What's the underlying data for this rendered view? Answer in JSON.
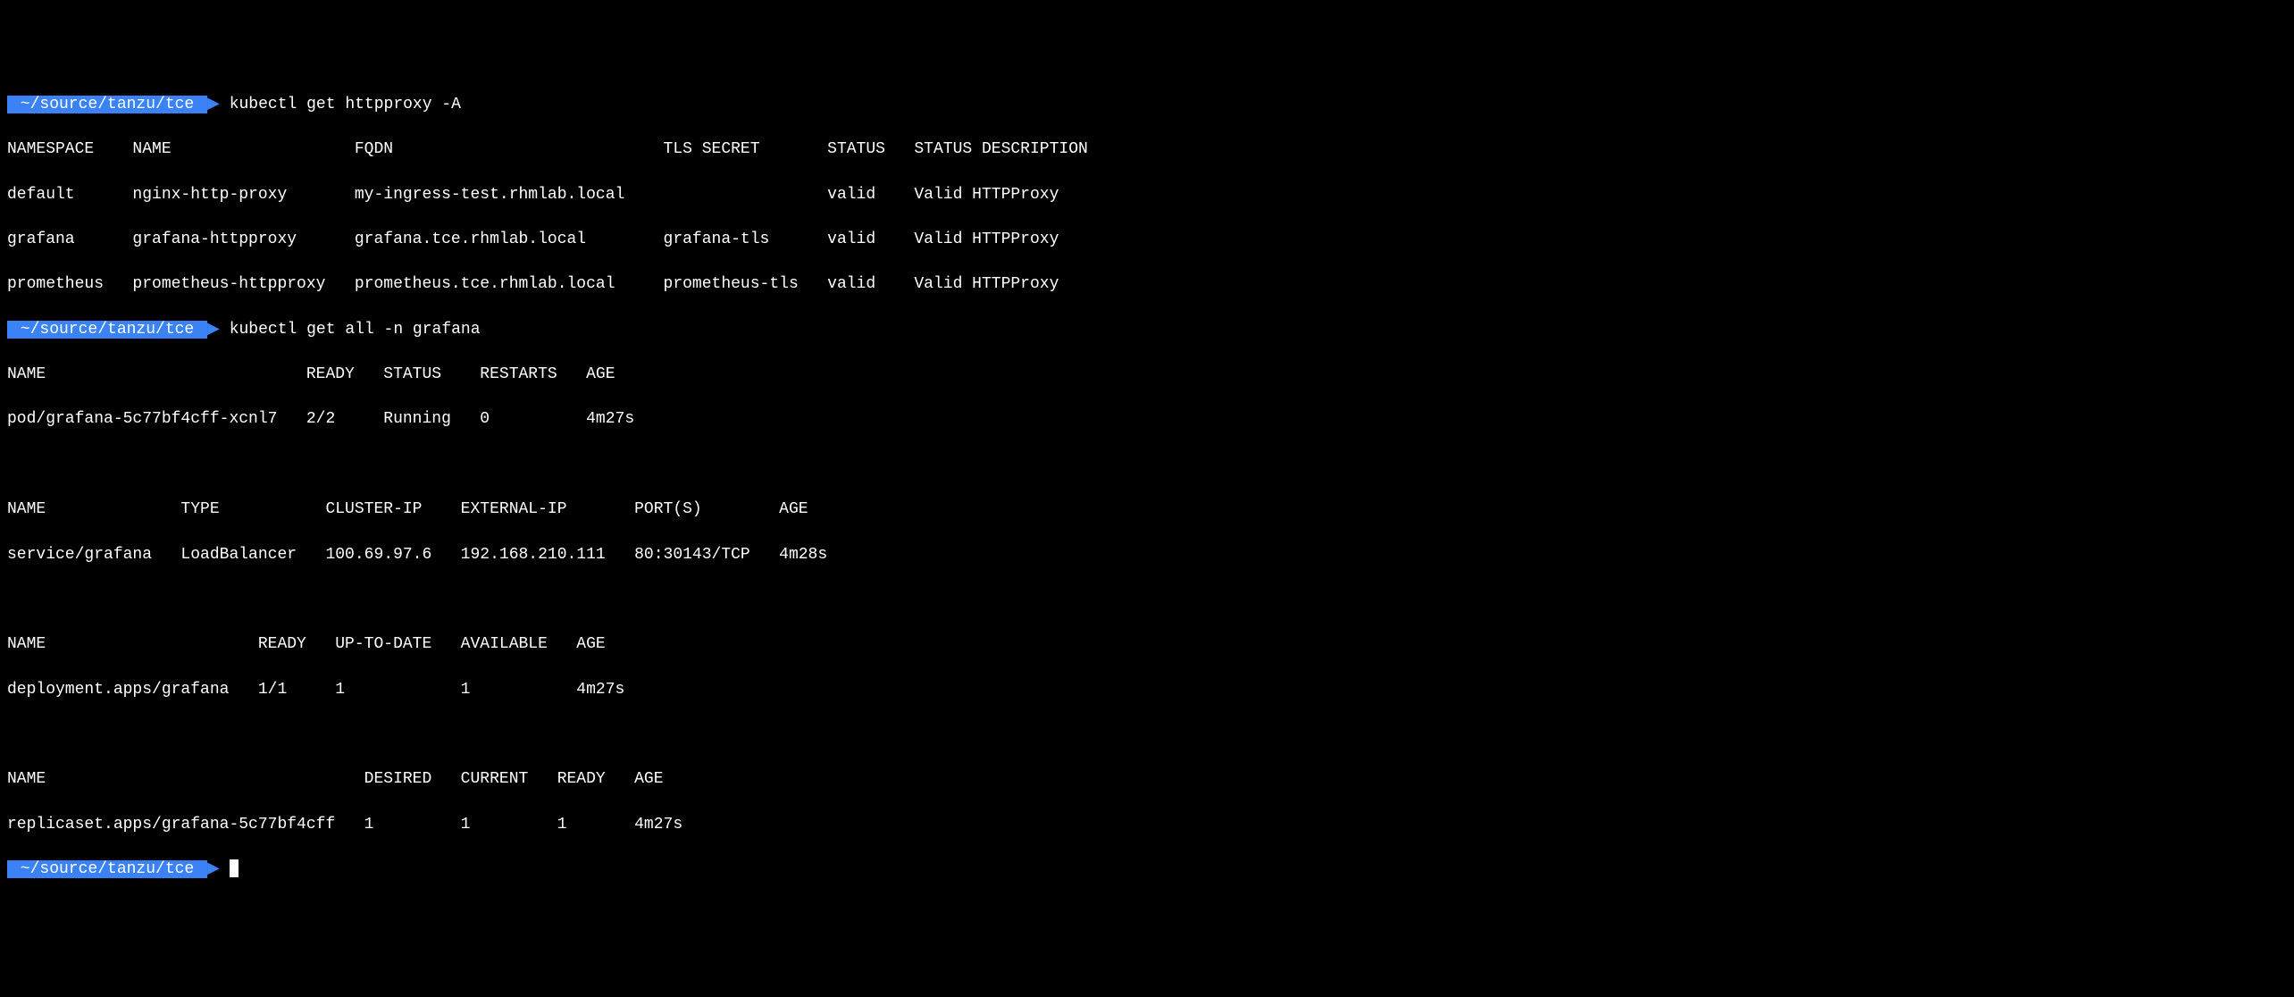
{
  "prompt_path": " ~/source/tanzu/tce ",
  "prompt_arrow": "▶",
  "commands": {
    "cmd1": " kubectl get httpproxy -A",
    "cmd2": " kubectl get all -n grafana"
  },
  "httpproxy": {
    "header": "NAMESPACE    NAME                   FQDN                            TLS SECRET       STATUS   STATUS DESCRIPTION",
    "rows": [
      "default      nginx-http-proxy       my-ingress-test.rhmlab.local                     valid    Valid HTTPProxy",
      "grafana      grafana-httpproxy      grafana.tce.rhmlab.local        grafana-tls      valid    Valid HTTPProxy",
      "prometheus   prometheus-httpproxy   prometheus.tce.rhmlab.local     prometheus-tls   valid    Valid HTTPProxy"
    ]
  },
  "pods": {
    "header": "NAME                           READY   STATUS    RESTARTS   AGE",
    "rows": [
      "pod/grafana-5c77bf4cff-xcnl7   2/2     Running   0          4m27s"
    ]
  },
  "services": {
    "header": "NAME              TYPE           CLUSTER-IP    EXTERNAL-IP       PORT(S)        AGE",
    "rows": [
      "service/grafana   LoadBalancer   100.69.97.6   192.168.210.111   80:30143/TCP   4m28s"
    ]
  },
  "deployments": {
    "header": "NAME                      READY   UP-TO-DATE   AVAILABLE   AGE",
    "rows": [
      "deployment.apps/grafana   1/1     1            1           4m27s"
    ]
  },
  "replicasets": {
    "header": "NAME                                 DESIRED   CURRENT   READY   AGE",
    "rows": [
      "replicaset.apps/grafana-5c77bf4cff   1         1         1       4m27s"
    ]
  }
}
